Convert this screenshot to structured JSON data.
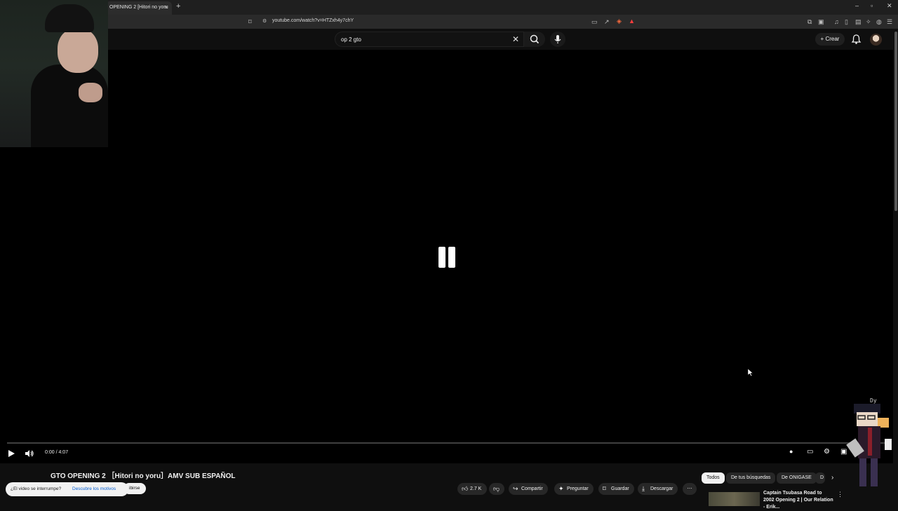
{
  "browser": {
    "tab_title": "OPENING 2 [Hitori no yoru",
    "tab_close": "×",
    "new_tab": "+",
    "url": "youtube.com/watch?v=HTZxh4y7chY",
    "window_controls": {
      "minimize": "–",
      "maximize": "▫",
      "close": "✕"
    }
  },
  "header": {
    "search_query": "op 2 gto",
    "clear_symbol": "✕",
    "create_label": "Crear"
  },
  "player": {
    "time_display": "0:00 / 4:07",
    "state": "paused"
  },
  "video": {
    "title": "GTO OPENING 2 ［Hitori no yoru］AMV SUB ESPAÑOL",
    "like_count": "2.7 K",
    "actions": {
      "share": "Compartir",
      "ask": "Preguntar",
      "save": "Guardar",
      "download": "Descargar"
    },
    "subscribe_partial": "ibirse"
  },
  "toast": {
    "question": "¿El video se interrumpe?",
    "link": "Descubre los motivos"
  },
  "recommendations": {
    "chips": [
      "Todos",
      "De tus búsquedas",
      "De ONIGASE",
      "D"
    ],
    "items": [
      {
        "title": "Captain Tsubasa Road to 2002 Opening 2 | Our Relation - Erik..."
      }
    ]
  },
  "overlay": {
    "sprite_label": "Dy"
  }
}
